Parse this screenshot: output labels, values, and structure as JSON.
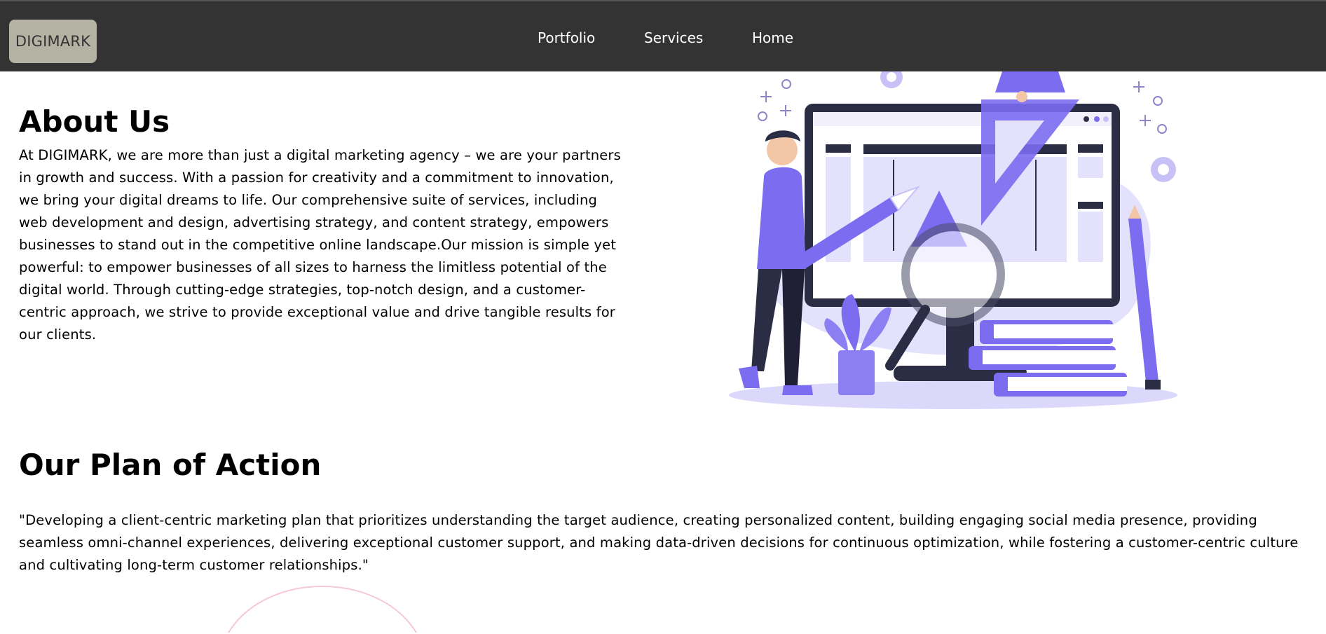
{
  "header": {
    "logo_text": "DIGIMARK",
    "nav": [
      {
        "label": "Portfolio"
      },
      {
        "label": "Services"
      },
      {
        "label": "Home"
      }
    ]
  },
  "about": {
    "title": "About Us",
    "text": "At DIGIMARK, we are more than just a digital marketing agency – we are your partners in growth and success. With a passion for creativity and a commitment to innovation, we bring your digital dreams to life. Our comprehensive suite of services, including web development and design, advertising strategy, and content strategy, empowers businesses to stand out in the competitive online landscape.Our mission is simple yet powerful: to empower businesses of all sizes to harness the limitless potential of the digital world. Through cutting-edge strategies, top-notch design, and a customer-centric approach, we strive to provide exceptional value and drive tangible results for our clients."
  },
  "plan": {
    "title": "Our Plan of Action",
    "text": "\"Developing a client-centric marketing plan that prioritizes understanding the target audience, creating personalized content, building engaging social media presence, providing seamless omni-channel experiences, delivering exceptional customer support, and making data-driven decisions for continuous optimization, while fostering a customer-centric culture and cultivating long-term customer relationships.\""
  },
  "colors": {
    "navbar": "#333333",
    "logo_bg": "#b4b3a3",
    "accent_purple": "#7b6cf0",
    "dark_navy": "#2b2d45"
  },
  "icons": {
    "illustration": "digital-marketing-illustration"
  }
}
